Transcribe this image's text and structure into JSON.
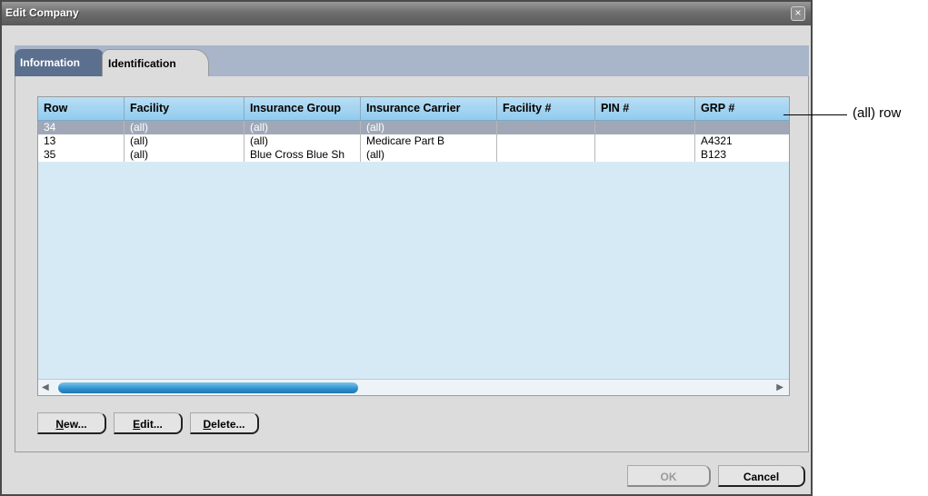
{
  "window": {
    "title": "Edit Company",
    "close_glyph": "×"
  },
  "tabs": [
    {
      "label": "Information",
      "active": false
    },
    {
      "label": "Identification",
      "active": true
    }
  ],
  "grid": {
    "columns": [
      "Row",
      "Facility",
      "Insurance Group",
      "Insurance Carrier",
      "Facility #",
      "PIN #",
      "GRP #"
    ],
    "rows": [
      [
        "34",
        "(all)",
        "(all)",
        "(all)",
        "",
        "",
        ""
      ],
      [
        "13",
        "(all)",
        "(all)",
        "Medicare Part B",
        "",
        "",
        "A4321"
      ],
      [
        "35",
        "(all)",
        "Blue Cross Blue Sh",
        "(all)",
        "",
        "",
        "B123"
      ]
    ],
    "selected_row_index": 0
  },
  "buttons": {
    "new": {
      "accel": "N",
      "rest": "ew..."
    },
    "edit": {
      "accel": "E",
      "rest": "dit..."
    },
    "delete": {
      "accel": "D",
      "rest": "elete..."
    },
    "ok": "OK",
    "cancel": "Cancel"
  },
  "callout": {
    "label": "(all) row"
  },
  "colors": {
    "selected_row": "#a0a8b8",
    "header": "#92cbee",
    "scroll_thumb": "#2c8fcc"
  }
}
